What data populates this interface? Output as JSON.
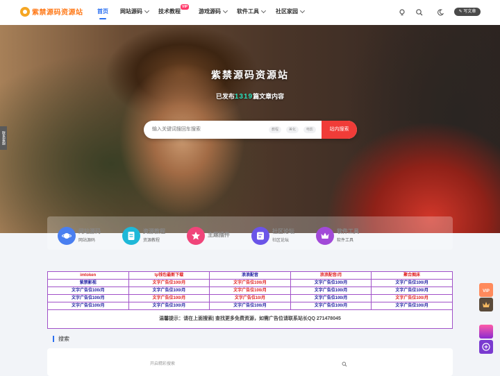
{
  "header": {
    "logo_text": "紫禁源码资源站",
    "nav": [
      {
        "label": "首页",
        "active": true,
        "caret": false
      },
      {
        "label": "网站源码",
        "caret": true
      },
      {
        "label": "技术教程",
        "badge": "VIP",
        "caret": false
      },
      {
        "label": "游戏源码",
        "caret": true
      },
      {
        "label": "软件工具",
        "caret": true
      },
      {
        "label": "社区家园",
        "caret": true
      }
    ],
    "icons": [
      "tips-icon",
      "search-icon",
      "moon-icon"
    ],
    "write_label": "写文章"
  },
  "hero": {
    "title": "紫禁源码资源站",
    "subtitle_prefix": "已发布",
    "post_count": "1319",
    "subtitle_suffix": "篇文章内容",
    "search_placeholder": "输入关键词搜回车搜索",
    "tags": [
      "教程",
      "美化",
      "电影"
    ],
    "search_button": "站内搜索",
    "side_tab": "联系客服"
  },
  "categories": [
    {
      "title": "网站源码",
      "sub": "网站源码",
      "color": "#4a7ff0",
      "icon": "planet-icon"
    },
    {
      "title": "资源教程",
      "sub": "资源教程",
      "color": "#1fb8d8",
      "icon": "file-icon"
    },
    {
      "title": "主题插件",
      "sub": "",
      "color": "#f0457a",
      "icon": "star-icon"
    },
    {
      "title": "社区论坛",
      "sub": "社区论坛",
      "color": "#6b55e8",
      "icon": "forum-icon"
    },
    {
      "title": "软件工具",
      "sub": "软件工具",
      "color": "#a24ad8",
      "icon": "crown-icon"
    }
  ],
  "ads": {
    "rows": [
      [
        {
          "t": "imtoken",
          "c": "red"
        },
        {
          "t": "tp钱包最新下载",
          "c": "red"
        },
        {
          "t": "浪浪配音",
          "c": "blue"
        },
        {
          "t": "浪浪配音/月",
          "c": "red"
        },
        {
          "t": "聚合图床",
          "c": "red"
        }
      ],
      [
        {
          "t": "紫禁影视",
          "c": "blue"
        },
        {
          "t": "文字广告位100/月",
          "c": "red"
        },
        {
          "t": "文字广告位100/月",
          "c": "red"
        },
        {
          "t": "文字广告位100/月",
          "c": "blue"
        },
        {
          "t": "文字广告位100/月",
          "c": "blue"
        }
      ],
      [
        {
          "t": "文字广告位100/月",
          "c": "blue"
        },
        {
          "t": "文字广告位100/月",
          "c": "blue"
        },
        {
          "t": "文字广告位100/月",
          "c": "red"
        },
        {
          "t": "文字广告位100/月",
          "c": "blue"
        },
        {
          "t": "文字广告位100/月",
          "c": "blue"
        }
      ],
      [
        {
          "t": "文字广告位100/月",
          "c": "blue"
        },
        {
          "t": "文字广告位100/月",
          "c": "red"
        },
        {
          "t": "文字广告位10/月",
          "c": "red"
        },
        {
          "t": "文字广告位100/月",
          "c": "blue"
        },
        {
          "t": "文字广告位100/月",
          "c": "red"
        }
      ],
      [
        {
          "t": "文字广告位100/月",
          "c": "blue"
        },
        {
          "t": "文字广告位100/月",
          "c": "blue"
        },
        {
          "t": "文字广告位100/月",
          "c": "blue"
        },
        {
          "t": "文字广告位100/月",
          "c": "blue"
        },
        {
          "t": "文字广告位100/月",
          "c": "blue"
        }
      ]
    ],
    "note": "温馨提示：请在上面搜索| 查找更多免费资源，如需广告位请联系站长QQ 271478045"
  },
  "search_section": {
    "title": "搜索",
    "placeholder": "开启精彩搜索"
  },
  "floats": [
    {
      "icon": "vip-icon",
      "color": "#ff8a5c"
    },
    {
      "icon": "crown-icon",
      "color": "#5a4a3a"
    },
    {
      "icon": "banner-icon",
      "color": "#c040c8"
    },
    {
      "icon": "plus-circle-icon",
      "color": "#7a3ad0"
    }
  ]
}
